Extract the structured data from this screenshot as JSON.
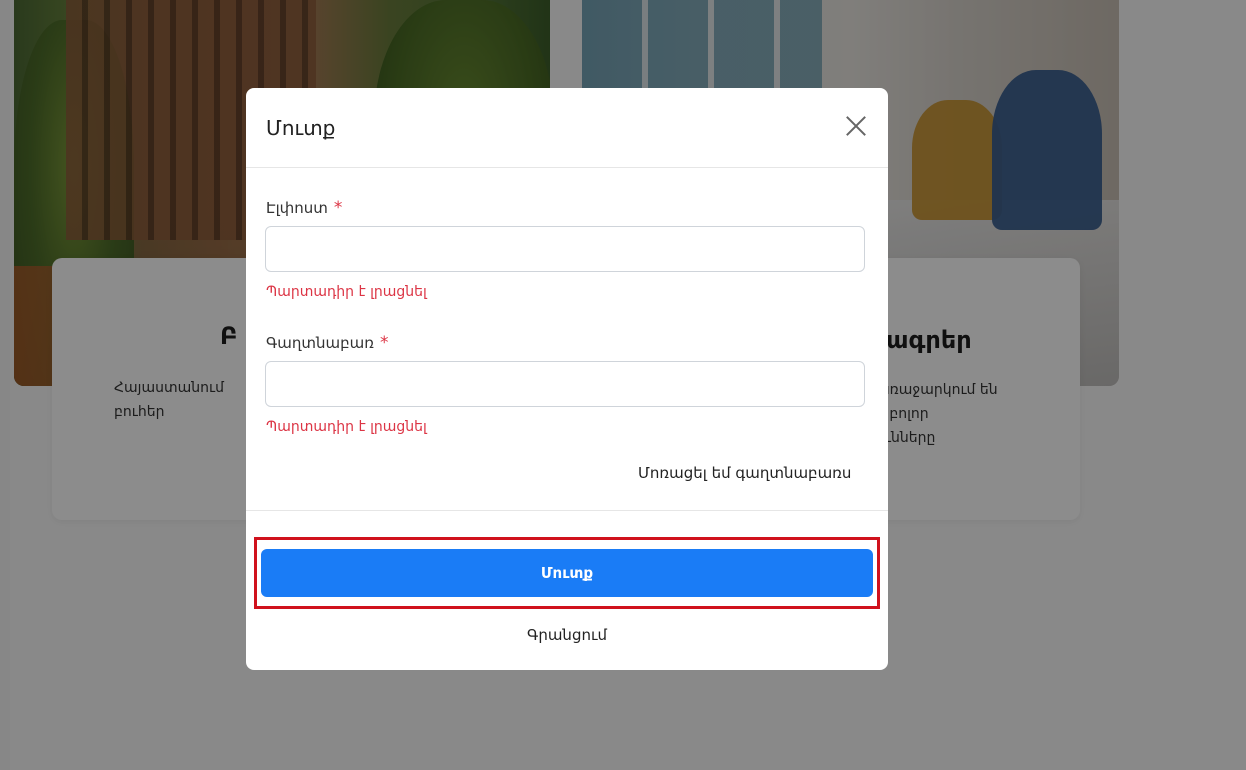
{
  "background": {
    "card_left": {
      "title": "Բ",
      "text": "Հայաստանում\nբուհեր"
    },
    "card_right": {
      "title": "ագրեր",
      "text": "առաջարկում են\nց բոլոր\nունները"
    }
  },
  "modal": {
    "title": "Մուտք",
    "email": {
      "label": "Էլփոստ",
      "required_mark": "*",
      "value": "",
      "error": "Պարտադիր է լրացնել"
    },
    "password": {
      "label": "Գաղտնաբառ",
      "required_mark": "*",
      "value": "",
      "error": "Պարտադիր է լրացնել"
    },
    "forgot_password": "Մոռացել եմ գաղտնաբառս",
    "submit_label": "Մուտք",
    "register_label": "Գրանցում"
  },
  "colors": {
    "primary": "#1a7cf6",
    "error": "#dc3545",
    "highlight": "#d0111d"
  },
  "icons": {
    "close": "close-icon"
  }
}
